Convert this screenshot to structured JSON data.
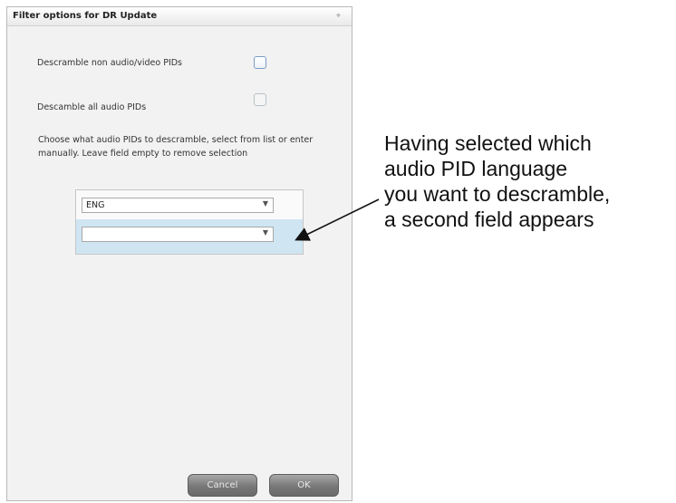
{
  "dialog": {
    "title": "Filter options for DR Update",
    "close_glyph": "⌖",
    "option_nonav": {
      "label": "Descramble non audio/video PIDs",
      "checked": false
    },
    "option_all_audio": {
      "label": "Descamble all audio PIDs",
      "checked": false,
      "enabled": false
    },
    "instruction": "Choose what audio PIDs to descramble, select from list or enter manually. Leave field empty to remove selection",
    "language_fields": [
      {
        "value": "ENG"
      },
      {
        "value": ""
      }
    ],
    "buttons": {
      "cancel": "Cancel",
      "ok": "OK"
    }
  },
  "annotation": {
    "lines": [
      "Having selected which",
      "audio PID language",
      "you want to descramble,",
      "a second field appears"
    ]
  },
  "colors": {
    "highlight_row": "#cfe6f2",
    "checkbox_border": "#7a9cc6",
    "button_fill": "#787878"
  }
}
